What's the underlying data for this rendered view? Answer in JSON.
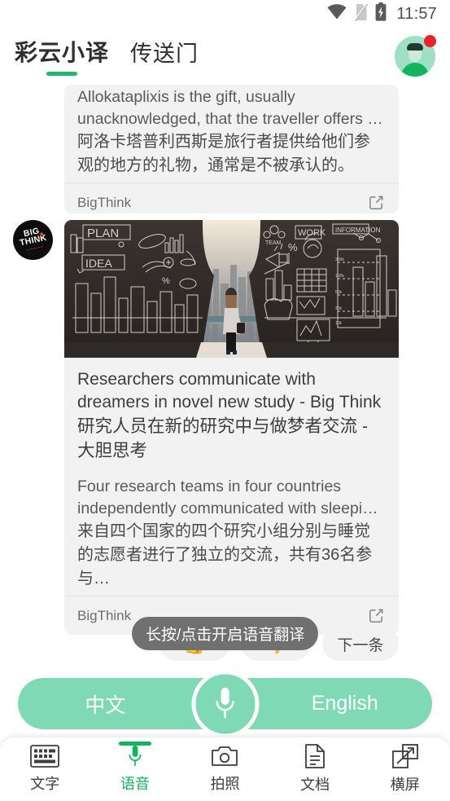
{
  "status_bar": {
    "time": "11:57",
    "icons": [
      "wifi-icon",
      "no-sim-icon",
      "battery-charging-icon"
    ]
  },
  "app_bar": {
    "tabs": [
      {
        "label": "彩云小译",
        "active": true
      },
      {
        "label": "传送门",
        "active": false
      }
    ],
    "avatar": {
      "name": "user-avatar",
      "badge": true
    },
    "accent_color": "#12b45e"
  },
  "feed": {
    "cards": [
      {
        "en_text": "Allokataplixis is the gift, usually unacknowledged, that the traveller offers …",
        "zh_text": "阿洛卡塔普利西斯是旅行者提供给他们参观的地方的礼物，通常是不被承认的。",
        "source": "BigThink",
        "share_icon": "share-icon"
      },
      {
        "logo": "bigthink-logo",
        "logo_text_1": "BIG",
        "logo_text_2": "THINK",
        "logo_sub": "—————",
        "image_alt": "chalkboard-keyhole-city-illustration",
        "title_en": "Researchers communicate with dreamers in novel new study - Big Think",
        "title_zh": "研究人员在新的研究中与做梦者交流 - 大胆思考",
        "body_en": "Four research teams in four countries independently communicated with sleepi…",
        "body_zh": "来自四个国家的四个研究小组分别与睡觉的志愿者进行了独立的交流，共有36名参与…",
        "source": "BigThink",
        "share_icon": "share-icon"
      }
    ]
  },
  "actions": {
    "thumbs_up": "👍",
    "thumbs_down": "👎",
    "next_label": "下一条",
    "tooltip": "长按/点击开启语音翻译",
    "tooltip_bg": "#707070"
  },
  "language_bar": {
    "source_language": "中文",
    "target_language": "English",
    "mic_icon": "microphone-icon",
    "color": "#7fd9b5"
  },
  "bottom_nav": {
    "items": [
      {
        "label": "文字",
        "icon": "keyboard-icon",
        "active": false
      },
      {
        "label": "语音",
        "icon": "microphone-icon",
        "active": true
      },
      {
        "label": "拍照",
        "icon": "camera-icon",
        "active": false
      },
      {
        "label": "文档",
        "icon": "document-icon",
        "active": false
      },
      {
        "label": "横屏",
        "icon": "landscape-rotate-icon",
        "active": false
      }
    ],
    "active_color": "#12b45e"
  }
}
